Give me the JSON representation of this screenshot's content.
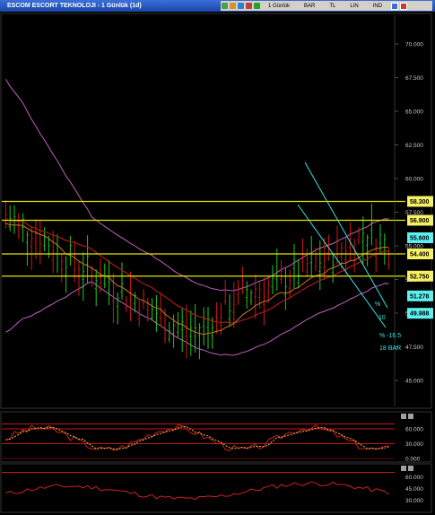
{
  "window": {
    "title": "ESCOM ESCORT TEKNOLOJI - 1 Günlük (1d)"
  },
  "toolbar": {
    "period": "1 Günlük",
    "chart_type": "BAR",
    "scale": "TL",
    "line": "LIN",
    "indicator": "IND"
  },
  "colors": {
    "background": "#000000",
    "up_bar": "#22c722",
    "down_bar": "#d01818",
    "hline": "#e6e600",
    "bollinger": "#c060c0",
    "ma_red": "#b01818",
    "ma_orange": "#c87820",
    "channel": "#39e3e3"
  },
  "main_axis": {
    "ticks": [
      "70.000",
      "67.500",
      "65.000",
      "62.500",
      "60.000",
      "57.500",
      "55.000",
      "52.500",
      "50.000",
      "47.500",
      "45.000"
    ]
  },
  "price_levels": [
    {
      "label": "58.300",
      "value": 58.3,
      "style": "yellow-box"
    },
    {
      "label": "56.900",
      "value": 56.9,
      "style": "yellow-box"
    },
    {
      "label": "55.600",
      "value": 55.6,
      "style": "cyan-box"
    },
    {
      "label": "54.400",
      "value": 54.4,
      "style": "yellow-box"
    },
    {
      "label": "52.750",
      "value": 52.75,
      "style": "yellow-box"
    },
    {
      "label": "51.278",
      "value": 51.278,
      "style": "cyan-box"
    },
    {
      "label": "49.988",
      "value": 49.988,
      "style": "cyan-box"
    }
  ],
  "annotations": {
    "pct": "%",
    "ten": "10",
    "pct_change": "% -16.5",
    "bars": "18 BAR"
  },
  "rsi_panel": {
    "ticks": [
      "60.000",
      "30.000",
      "0.000"
    ]
  },
  "lower_panel": {
    "ticks": [
      "60.000",
      "45.000",
      "30.000"
    ]
  }
}
